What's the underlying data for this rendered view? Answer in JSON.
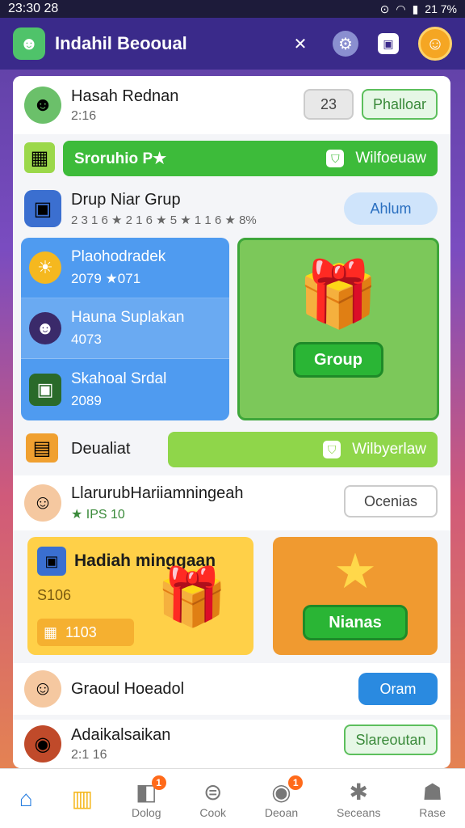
{
  "status_bar": {
    "time": "23:30 28",
    "battery": "21 7%"
  },
  "app": {
    "title": "Indahil Beooual"
  },
  "header_icons": {
    "close": "✕",
    "tool": "⚙",
    "chat": "▣",
    "avatar": "☺"
  },
  "rows": {
    "r1": {
      "name": "Hasah Rednan",
      "sub": "2:16",
      "count": "23",
      "action": "Phalloar"
    },
    "bar1": {
      "label": "Sroruhio P★",
      "right": "Wilfoeuaw"
    },
    "r2": {
      "name": "Drup Niar Grup",
      "sub": "2 3 1 6  ★ 2 1 6  ★ 5  ★ 1 1 6  ★ 8%",
      "action": "Ahlum"
    },
    "bar2": {
      "label": "Deualiat",
      "right": "Wilbyerlaw"
    },
    "r3": {
      "name": "LlarurubHariiamningeah",
      "sub": "★ IPS 10",
      "action": "Ocenias"
    },
    "r4": {
      "name": "Graoul Hoeadol",
      "action": "Oram"
    },
    "r5": {
      "name": "Adaikalsaikan",
      "sub": "2:1 16",
      "action": "Slareoutan"
    }
  },
  "blue_panel": [
    {
      "title": "Plaohodradek",
      "value": "2079  ★071",
      "icon": "☀"
    },
    {
      "title": "Hauna Suplakan",
      "value": "4073",
      "icon": "☻"
    },
    {
      "title": "Skahoal Srdal",
      "value": "2089",
      "icon": "▣"
    }
  ],
  "green_panel": {
    "button": "Group",
    "gift_icon": "gift-icon"
  },
  "yellow_panel": {
    "title": "Hadiah minggaan",
    "v1": "S106",
    "v2": "1103"
  },
  "orange_panel": {
    "button": "Nianas",
    "star_icon": "star-icon"
  },
  "bottom_nav": [
    {
      "label": "",
      "icon": "home-icon",
      "glyph": "⌂",
      "color": "#2a7fe0"
    },
    {
      "label": "",
      "icon": "shop-icon",
      "glyph": "▥",
      "color": "#f5b81f"
    },
    {
      "label": "Dolog",
      "icon": "doc-icon",
      "glyph": "◧",
      "color": "#888",
      "badge": "1"
    },
    {
      "label": "Cook",
      "icon": "gear-icon",
      "glyph": "⊜",
      "color": "#888"
    },
    {
      "label": "Deoan",
      "icon": "message-icon",
      "glyph": "◉",
      "color": "#888",
      "badge": "1"
    },
    {
      "label": "Seceans",
      "icon": "asterisk-icon",
      "glyph": "✱",
      "color": "#888"
    },
    {
      "label": "Rase",
      "icon": "profile-icon",
      "glyph": "☗",
      "color": "#888"
    }
  ]
}
